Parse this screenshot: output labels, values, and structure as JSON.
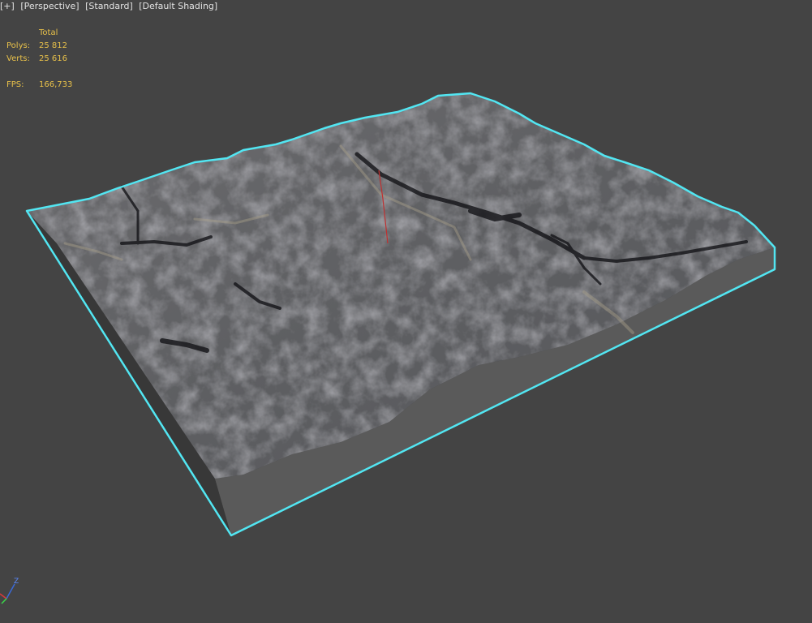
{
  "viewport": {
    "labels": [
      "[+]",
      "[Perspective]",
      "[Standard]",
      "[Default Shading]"
    ]
  },
  "stats": {
    "header": "Total",
    "polys_label": "Polys:",
    "polys_value": "25 812",
    "verts_label": "Verts:",
    "verts_value": "25 616",
    "fps_label": "FPS:",
    "fps_value": "166,733"
  },
  "axis": {
    "z": "Z"
  },
  "colors": {
    "background": "#444444",
    "selection": "#52e6f2",
    "stats_text": "#e8c14a",
    "terrain": "#5e5e60"
  },
  "icons": {
    "gizmo": "axis-gizmo-icon"
  }
}
